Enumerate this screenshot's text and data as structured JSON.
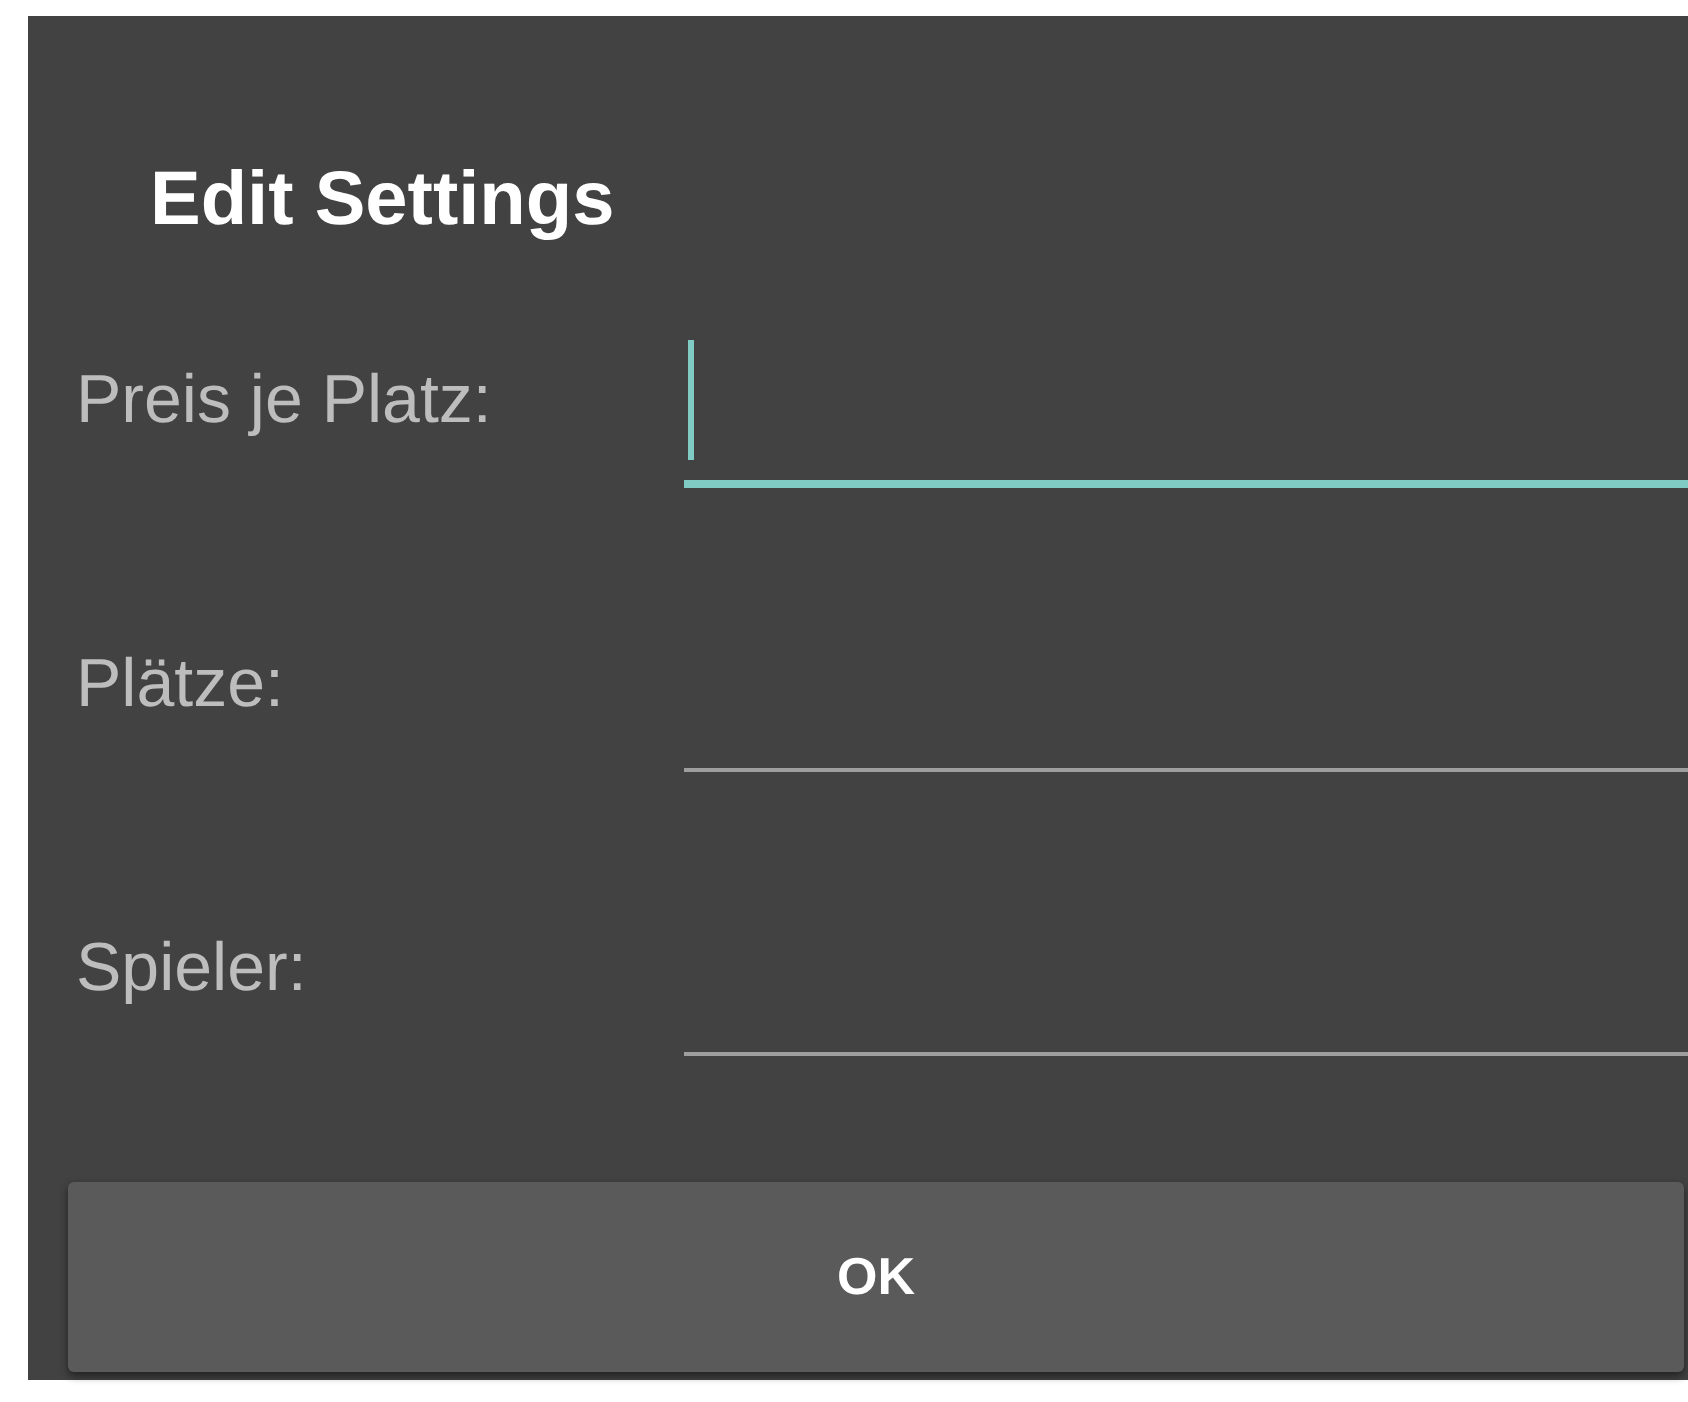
{
  "dialog": {
    "title": "Edit Settings"
  },
  "fields": [
    {
      "label": "Preis je Platz:",
      "focused": true
    },
    {
      "label": "Plätze:",
      "focused": false
    },
    {
      "label": "Spieler:",
      "focused": false
    }
  ],
  "button": {
    "label": "OK"
  }
}
